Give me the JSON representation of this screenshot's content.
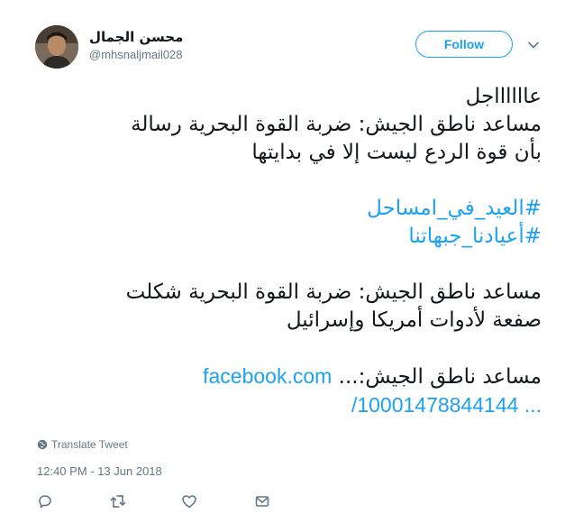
{
  "user": {
    "display_name": "محسن الجمال",
    "handle": "@mhsnaljmail028"
  },
  "follow_button": {
    "label": "Follow"
  },
  "tweet": {
    "lines": [
      "عااااااجل",
      "مساعد ناطق الجيش: ضربة القوة البحرية رسالة",
      "بأن قوة الردع ليست إلا في بدايتها"
    ],
    "hashtags": [
      "#العيد_في_امساحل",
      "#أعيادنا_جبهاتنا"
    ],
    "para2_lines": [
      "مساعد ناطق الجيش: ضربة القوة البحرية شكلت",
      "صفعة لأدوات أمريكا وإسرائيل"
    ],
    "para3_prefix": "مساعد ناطق الجيش:...",
    "link_domain": "facebook.com",
    "link_path": "/10001478844144 ..."
  },
  "translate_label": "Translate Tweet",
  "timestamp": "12:40 PM - 13 Jun 2018",
  "colors": {
    "accent": "#1da1f2",
    "text": "#14171a",
    "muted": "#657786"
  }
}
